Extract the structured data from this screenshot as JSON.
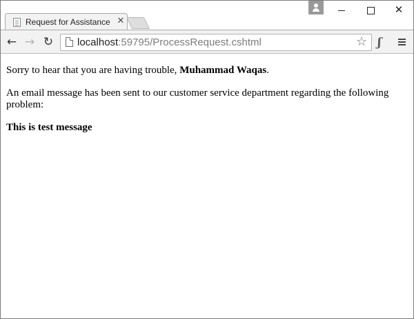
{
  "browser": {
    "tab": {
      "title": "Request for Assistance",
      "close_glyph": "✕"
    },
    "window_controls": {
      "minimize": "minimize-icon",
      "maximize": "maximize-icon",
      "close_glyph": "✕"
    },
    "toolbar": {
      "back_glyph": "←",
      "forward_glyph": "→",
      "reload_glyph": "↻",
      "url_host": "localhost",
      "url_rest": ":59795/ProcessRequest.cshtml",
      "star_glyph": "☆",
      "extension_glyph": "ʃ"
    }
  },
  "page": {
    "greeting_prefix": "Sorry to hear that you are having trouble, ",
    "user_name": "Muhammad Waqas",
    "greeting_suffix": ".",
    "email_notice": "An email message has been sent to our customer service department regarding the following problem:",
    "problem_message": "This is test message"
  }
}
